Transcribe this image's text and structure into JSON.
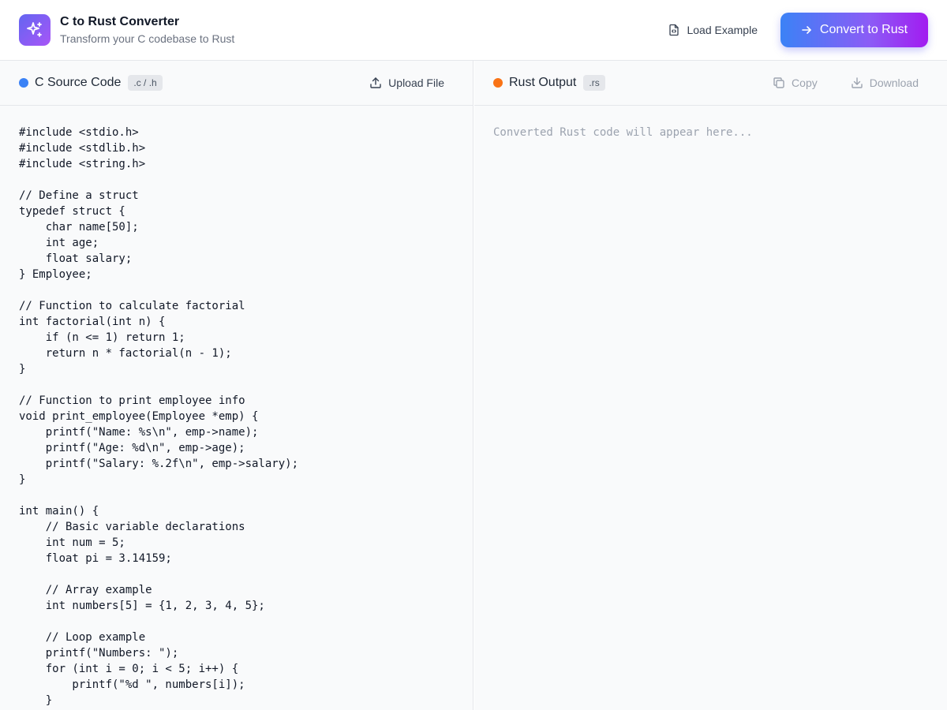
{
  "header": {
    "title": "C to Rust Converter",
    "subtitle": "Transform your C codebase to Rust",
    "load_example_label": "Load Example",
    "convert_label": "Convert to Rust",
    "logo_icon": "sparkles-icon"
  },
  "source_panel": {
    "title": "C Source Code",
    "badge": ".c / .h",
    "upload_label": "Upload File",
    "indicator_color": "#3b82f6",
    "code_lines": [
      "#include <stdio.h>",
      "#include <stdlib.h>",
      "#include <string.h>",
      "",
      "// Define a struct",
      "typedef struct {",
      "    char name[50];",
      "    int age;",
      "    float salary;",
      "} Employee;",
      "",
      "// Function to calculate factorial",
      "int factorial(int n) {",
      "    if (n <= 1) return 1;",
      "    return n * factorial(n - 1);",
      "}",
      "",
      "// Function to print employee info",
      "void print_employee(Employee *emp) {",
      "    printf(\"Name: %s\\n\", emp->name);",
      "    printf(\"Age: %d\\n\", emp->age);",
      "    printf(\"Salary: %.2f\\n\", emp->salary);",
      "}",
      "",
      "int main() {",
      "    // Basic variable declarations",
      "    int num = 5;",
      "    float pi = 3.14159;",
      "",
      "    // Array example",
      "    int numbers[5] = {1, 2, 3, 4, 5};",
      "",
      "    // Loop example",
      "    printf(\"Numbers: \");",
      "    for (int i = 0; i < 5; i++) {",
      "        printf(\"%d \", numbers[i]);",
      "    }"
    ]
  },
  "output_panel": {
    "title": "Rust Output",
    "badge": ".rs",
    "copy_label": "Copy",
    "download_label": "Download",
    "placeholder": "Converted Rust code will appear here...",
    "indicator_color": "#f97316"
  }
}
